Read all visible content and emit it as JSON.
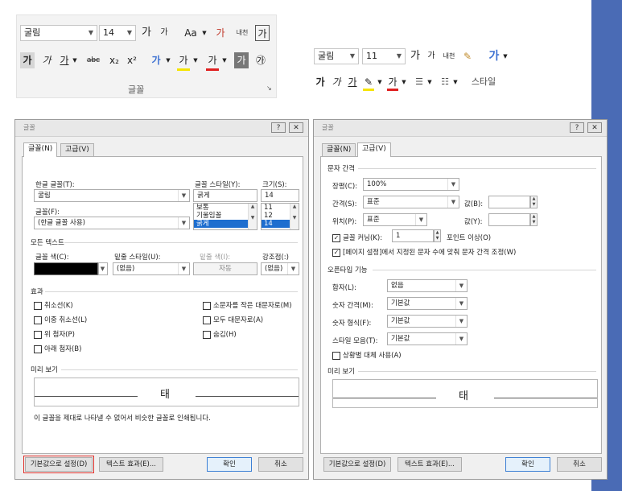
{
  "ribbon": {
    "font_name": "굴림",
    "font_size": "14",
    "grow_font": "가",
    "shrink_font": "가",
    "case_btn": "Aa",
    "clear_btn": "가",
    "ruby_btn": "내천",
    "border_btn": "가",
    "bold": "가",
    "italic": "가",
    "underline": "가",
    "strike": "abc",
    "subscript": "x₂",
    "superscript": "x²",
    "effects": "가",
    "highlight": "가",
    "font_color": "가",
    "shade": "가",
    "enclose": "㉮",
    "group_label": "글꼴",
    "highlight_color": "#f5e400",
    "font_color_bar": "#e02020"
  },
  "mini": {
    "font_name": "굴림",
    "font_size": "11",
    "grow": "가",
    "shrink": "가",
    "ruby": "내천",
    "style_icon": "가",
    "bold": "가",
    "italic": "가",
    "underline": "가",
    "styles_label": "스타일"
  },
  "dialog1": {
    "title": "글꼴",
    "tabs": [
      "글꼴(N)",
      "고급(V)"
    ],
    "korean_font_label": "한글 글꼴(T):",
    "korean_font": "굴림",
    "font_label": "글꼴(F):",
    "font_value": "(한글 글꼴 사용)",
    "style_label": "글꼴 스타일(Y):",
    "style_value": "굵게",
    "style_list": [
      "보통",
      "기울임꼴",
      "굵게"
    ],
    "size_label": "크기(S):",
    "size_value": "14",
    "size_list": [
      "11",
      "12",
      "14"
    ],
    "all_text_section": "모든 텍스트",
    "font_color_label": "글꼴 색(C):",
    "underline_style_label": "밑줄 스타일(U):",
    "underline_style": "(없음)",
    "underline_color_label": "밑줄 색(I):",
    "underline_color": "자동",
    "emphasis_label": "강조점(:)",
    "emphasis": "(없음)",
    "effects_section": "효과",
    "effects_left": [
      "취소선(K)",
      "이중 취소선(L)",
      "위 첨자(P)",
      "아래 첨자(B)"
    ],
    "effects_right": [
      "소문자를 작은 대문자로(M)",
      "모두 대문자로(A)",
      "숨김(H)"
    ],
    "preview_section": "미리 보기",
    "preview_text": "태",
    "preview_note": "이 글꼴을 제대로 나타낼 수 없어서 비슷한 글꼴로 인쇄됩니다.",
    "default_btn": "기본값으로 설정(D)",
    "text_effects_btn": "텍스트 효과(E)...",
    "ok_btn": "확인",
    "cancel_btn": "취소"
  },
  "dialog2": {
    "title": "글꼴",
    "tabs": [
      "글꼴(N)",
      "고급(V)"
    ],
    "spacing_section": "문자 간격",
    "scale_label": "장평(C):",
    "scale_value": "100%",
    "spacing_label": "간격(S):",
    "spacing_value": "표준",
    "by_label": "값(B):",
    "position_label": "위치(P):",
    "position_value": "표준",
    "by2_label": "값(Y):",
    "kerning_label": "글꼴 커닝(K):",
    "kerning_value": "1",
    "kerning_suffix": "포인트 이상(O)",
    "grid_label": "[페이지 설정]에서 지정된 문자 수에 맞춰 문자 간격 조정(W)",
    "opentype_section": "오픈타입 기능",
    "ligatures_label": "합자(L):",
    "ligatures_value": "없음",
    "num_spacing_label": "숫자 간격(M):",
    "num_spacing_value": "기본값",
    "num_forms_label": "숫자 형식(F):",
    "num_forms_value": "기본값",
    "stylistic_label": "스타일 모음(T):",
    "stylistic_value": "기본값",
    "contextual_label": "상황별 대체 사용(A)",
    "preview_section": "미리 보기",
    "preview_text": "태",
    "default_btn": "기본값으로 설정(D)",
    "text_effects_btn": "텍스트 효과(E)...",
    "ok_btn": "확인",
    "cancel_btn": "취소"
  }
}
